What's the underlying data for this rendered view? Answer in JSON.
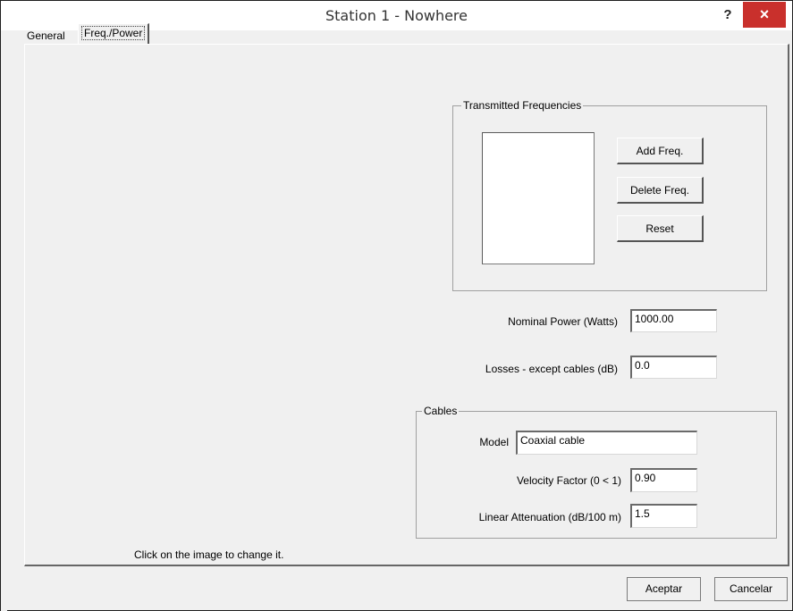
{
  "window": {
    "title": "Station 1 - Nowhere",
    "help_label": "?",
    "close_label": "×"
  },
  "tabs": [
    {
      "label": "General"
    },
    {
      "label": "Freq./Power"
    }
  ],
  "transmitted_frequencies": {
    "legend": "Transmitted Frequencies",
    "add_label": "Add Freq.",
    "delete_label": "Delete Freq.",
    "reset_label": "Reset"
  },
  "power": {
    "nominal_label": "Nominal Power (Watts)",
    "nominal_value": "1000.00",
    "losses_label": "Losses - except cables (dB)",
    "losses_value": "0.0"
  },
  "cables": {
    "legend": "Cables",
    "model_label": "Model",
    "model_value": "Coaxial cable",
    "velocity_label": "Velocity Factor (0 < 1)",
    "velocity_value": "0.90",
    "attenuation_label": "Linear Attenuation (dB/100 m)",
    "attenuation_value": "1.5"
  },
  "hint": "Click on the image to change it.",
  "footer": {
    "ok_label": "Aceptar",
    "cancel_label": "Cancelar"
  }
}
